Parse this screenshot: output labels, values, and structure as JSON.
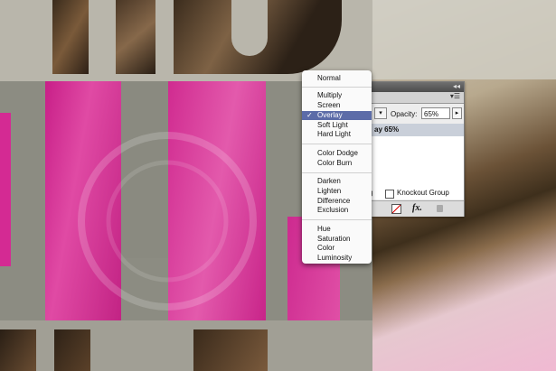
{
  "blend_menu": {
    "items": [
      {
        "label": "Normal"
      },
      {
        "label": "Multiply"
      },
      {
        "label": "Screen"
      },
      {
        "label": "Overlay",
        "checked": true
      },
      {
        "label": "Soft Light"
      },
      {
        "label": "Hard Light"
      },
      {
        "label": "Color Dodge"
      },
      {
        "label": "Color Burn"
      },
      {
        "label": "Darken"
      },
      {
        "label": "Lighten"
      },
      {
        "label": "Difference"
      },
      {
        "label": "Exclusion"
      },
      {
        "label": "Hue"
      },
      {
        "label": "Saturation"
      },
      {
        "label": "Color"
      },
      {
        "label": "Luminosity"
      }
    ],
    "check_mark": "✓"
  },
  "transparency_panel": {
    "opacity_label": "Opacity:",
    "opacity_value": "65%",
    "layer_label": "ay 65%",
    "isolate_fragment": "g",
    "knockout_label": "Knockout Group",
    "fx_label": "fx."
  },
  "colors": {
    "magenta": "#d42a93",
    "menu_selection": "#5c6ca8",
    "panel_bg": "#ededed"
  }
}
